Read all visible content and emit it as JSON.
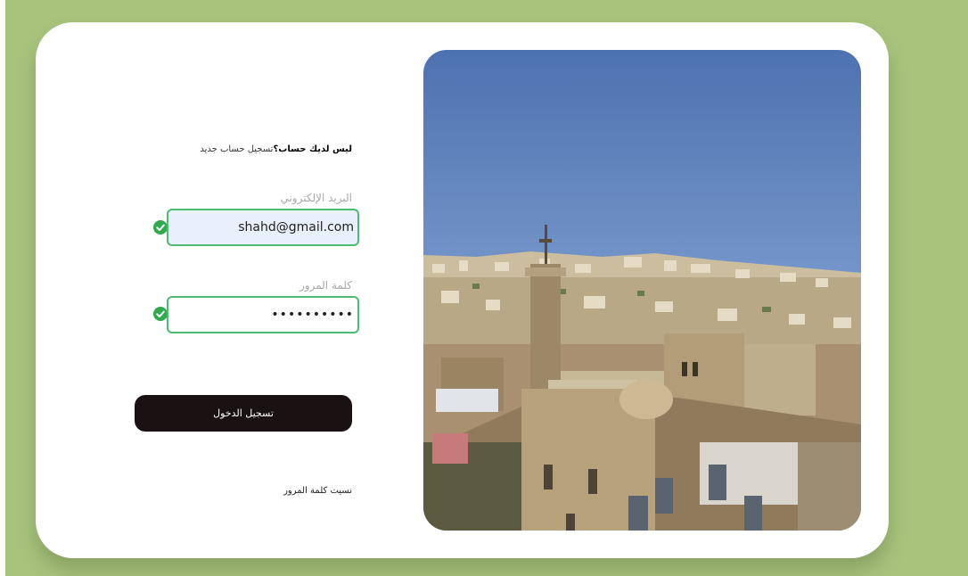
{
  "signup": {
    "question": "ليس لديك حساب؟",
    "link": "تسجيل حساب جديد"
  },
  "email": {
    "label": "البريد الإلكتروني",
    "value": "shahd@gmail.com"
  },
  "password": {
    "label": "كلمة المرور",
    "value": "••••••••••"
  },
  "login_button": "تسجيل الدخول",
  "forgot_password": "نسيت كلمة المرور",
  "photo": {
    "subject": "city-skyline-photo"
  },
  "colors": {
    "background": "#a8c47c",
    "valid": "#4cbb73",
    "button": "#1a1212",
    "email_fill": "#e8f0fb"
  }
}
